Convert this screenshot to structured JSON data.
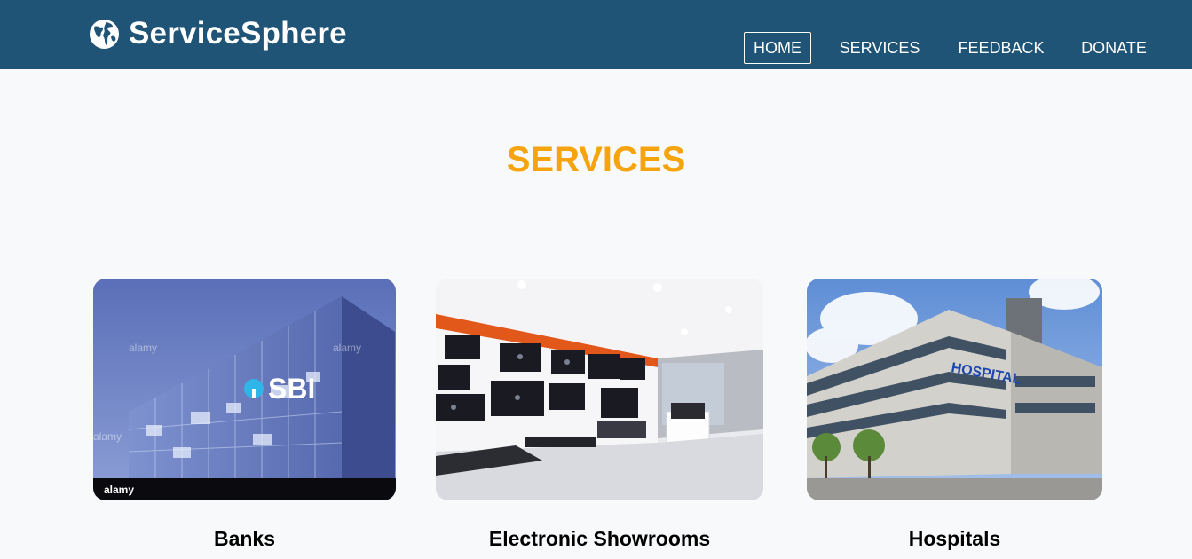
{
  "brand": {
    "name": "ServiceSphere",
    "icon": "globe-icon"
  },
  "nav": {
    "items": [
      {
        "label": "HOME",
        "active": true
      },
      {
        "label": "SERVICES",
        "active": false
      },
      {
        "label": "FEEDBACK",
        "active": false
      },
      {
        "label": "DONATE",
        "active": false
      }
    ]
  },
  "page": {
    "section_title": "SERVICES"
  },
  "services": [
    {
      "label": "Banks",
      "image_logo_text": "SBI",
      "watermark": "alamy"
    },
    {
      "label": "Electronic Showrooms"
    },
    {
      "label": "Hospitals",
      "image_sign_text": "HOSPITAL"
    }
  ],
  "colors": {
    "navbar": "#1f5477",
    "title": "#f5a40d",
    "page_bg": "#f8f9fa",
    "nav_text": "#ffffff"
  }
}
